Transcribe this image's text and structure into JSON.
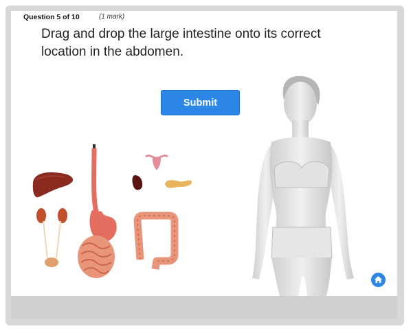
{
  "question": {
    "number_label": "Question 5 of 10",
    "mark_label": "(1 mark)",
    "prompt": "Drag and drop the large intestine onto its correct location in the abdomen."
  },
  "submit_button": {
    "label": "Submit"
  },
  "organs": [
    {
      "name": "liver",
      "icon": "liver-icon"
    },
    {
      "name": "esophagus-stomach",
      "icon": "stomach-icon"
    },
    {
      "name": "small-intestine",
      "icon": "small-intestine-icon"
    },
    {
      "name": "kidneys-bladder",
      "icon": "kidney-icon"
    },
    {
      "name": "uterus",
      "icon": "uterus-icon"
    },
    {
      "name": "spleen",
      "icon": "spleen-icon"
    },
    {
      "name": "pancreas",
      "icon": "pancreas-icon"
    },
    {
      "name": "large-intestine",
      "icon": "large-intestine-icon"
    }
  ],
  "home_button": {
    "icon": "home-icon"
  },
  "colors": {
    "accent": "#2b86e6",
    "liver": "#8b2a1e",
    "stomach": "#e36d5e",
    "intestine": "#e9957a",
    "spleen": "#5a1414",
    "pancreas": "#e8b35a"
  }
}
